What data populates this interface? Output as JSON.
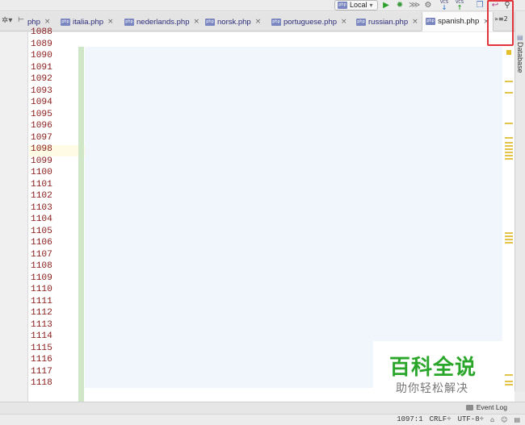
{
  "toolbar": {
    "run_config_label": "Local",
    "run_config_badge": "php",
    "icons": [
      "run-icon",
      "debug-icon",
      "coverage-icon",
      "profile-icon",
      "vcs-update-icon",
      "vcs-commit-icon",
      "compare-icon",
      "undo-icon",
      "search-icon"
    ],
    "vcs_text": "VCS"
  },
  "tabs": {
    "items": [
      {
        "label": "php",
        "truncated": true
      },
      {
        "label": "italia.php"
      },
      {
        "label": "nederlands.php"
      },
      {
        "label": "norsk.php"
      },
      {
        "label": "portuguese.php"
      },
      {
        "label": "russian.php"
      },
      {
        "label": "spanish.php",
        "active": true
      }
    ],
    "file_badge": "php",
    "close_glyph": "×",
    "overflow_label": "»≡2"
  },
  "side_panel": {
    "label": "Database"
  },
  "editor": {
    "line_numbers": [
      "1088",
      "1089",
      "1090",
      "1091",
      "1092",
      "1093",
      "1094",
      "1095",
      "1096",
      "1097",
      "1098",
      "1099",
      "1100",
      "1101",
      "1102",
      "1103",
      "1104",
      "1105",
      "1106",
      "1107",
      "1108",
      "1109",
      "1110",
      "1111",
      "1112",
      "1113",
      "1114",
      "1115",
      "1116",
      "1117",
      "1118"
    ],
    "current_line": "1097"
  },
  "watermark": {
    "title": "百科全说",
    "subtitle": "助你轻松解决"
  },
  "bottom": {
    "event_log_label": "Event Log"
  },
  "status": {
    "position": "1097:1",
    "line_separator": "CRLF÷",
    "encoding": "UTF-8÷"
  },
  "colors": {
    "accent_highlight": "#e0333b",
    "fold_bar": "#cfe6c7",
    "watermark_green": "#2aa62a"
  }
}
